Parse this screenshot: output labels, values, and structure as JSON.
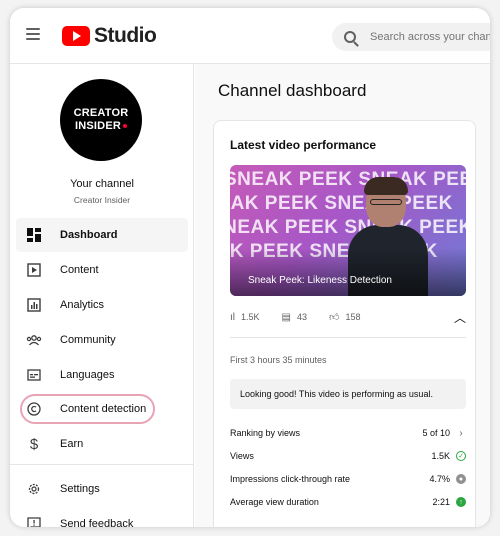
{
  "header": {
    "logo_text": "Studio",
    "search_placeholder": "Search across your channel"
  },
  "sidebar": {
    "avatar_line1": "CREATOR",
    "avatar_line2": "INSIDER",
    "channel_title": "Your channel",
    "channel_name": "Creator Insider",
    "items": [
      {
        "label": "Dashboard",
        "icon": "dashboard-icon",
        "active": true
      },
      {
        "label": "Content",
        "icon": "content-icon"
      },
      {
        "label": "Analytics",
        "icon": "analytics-icon"
      },
      {
        "label": "Community",
        "icon": "community-icon"
      },
      {
        "label": "Languages",
        "icon": "languages-icon"
      },
      {
        "label": "Content detection",
        "icon": "content-detection-icon"
      },
      {
        "label": "Earn",
        "icon": "earn-icon"
      },
      {
        "label": "Settings",
        "icon": "settings-icon"
      },
      {
        "label": "Send feedback",
        "icon": "feedback-icon"
      }
    ]
  },
  "main": {
    "page_title": "Channel dashboard",
    "card": {
      "title": "Latest video performance",
      "thumbnail_text": "SNEAK PEEK",
      "video_title": "Sneak Peek: Likeness Detection",
      "stats": {
        "views": "1.5K",
        "comments": "43",
        "likes": "158"
      },
      "first_time": "First 3 hours 35 minutes",
      "banner": "Looking good! This video is performing as usual.",
      "metrics": [
        {
          "label": "Ranking by views",
          "value": "5 of 10",
          "icon": "chevron-right-icon"
        },
        {
          "label": "Views",
          "value": "1.5K",
          "icon": "check-circle-icon"
        },
        {
          "label": "Impressions click-through rate",
          "value": "4.7%",
          "icon": "neutral-circle-icon"
        },
        {
          "label": "Average view duration",
          "value": "2:21",
          "icon": "up-arrow-icon"
        }
      ]
    }
  },
  "colors": {
    "brand": "#ff0000",
    "highlight": "#e8a3b5",
    "good": "#2ba640"
  }
}
